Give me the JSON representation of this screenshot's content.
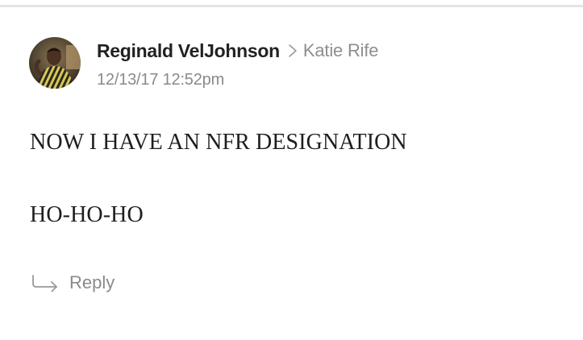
{
  "comment": {
    "author": {
      "name": "Reginald VelJohnson",
      "avatar_icon": "user-avatar"
    },
    "recipient": "Katie Rife",
    "reply_chevron_icon": "chevron-right-icon",
    "timestamp": "12/13/17 12:52pm",
    "body": {
      "line_1": "NOW I HAVE AN NFR DESIGNATION",
      "line_2": "HO-HO-HO"
    },
    "reply": {
      "label": "Reply",
      "icon": "reply-arrow-icon"
    }
  },
  "colors": {
    "author_text": "#222222",
    "meta_text": "#8a8a8a",
    "body_text": "#1e1e1e",
    "divider": "#e4e4e4"
  }
}
